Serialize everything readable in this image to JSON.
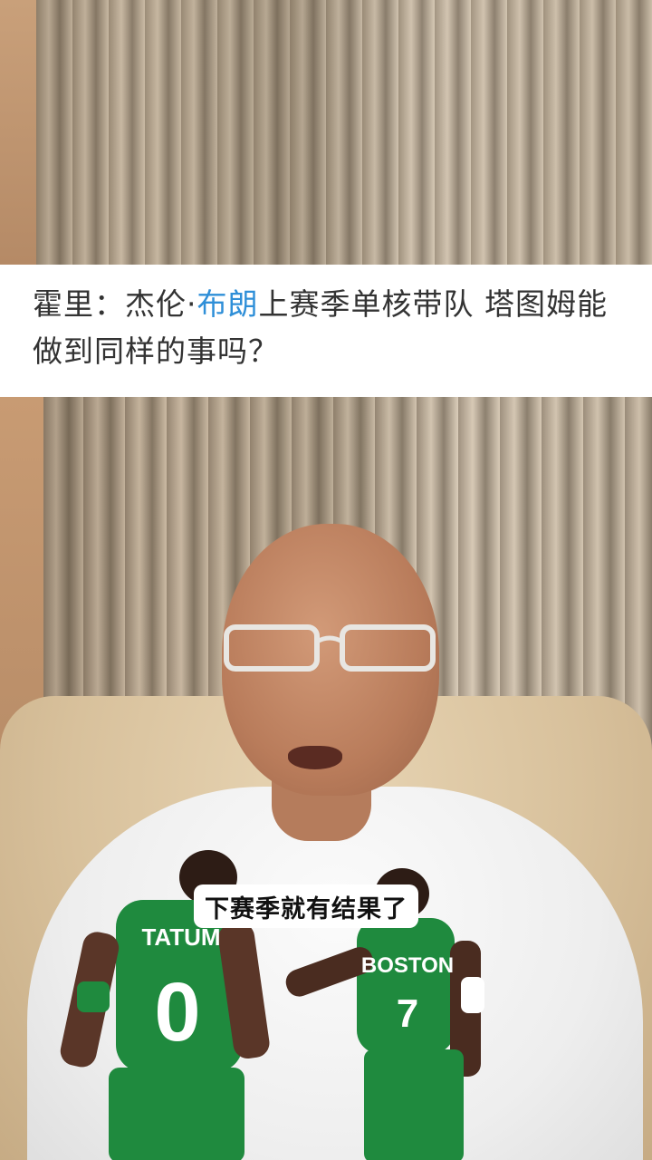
{
  "headline": {
    "prefix": "霍里：杰伦·",
    "highlight": "布朗",
    "suffix": "上赛季单核带队 塔图姆能做到同样的事吗？"
  },
  "video": {
    "caption": "下赛季就有结果了",
    "player_left": {
      "name": "TATUM",
      "number": "0"
    },
    "player_right": {
      "team": "BOSTON",
      "number": "7"
    }
  },
  "colors": {
    "highlight": "#2f8fd8",
    "jersey": "#1f8a3e",
    "headline_text": "#333333"
  }
}
